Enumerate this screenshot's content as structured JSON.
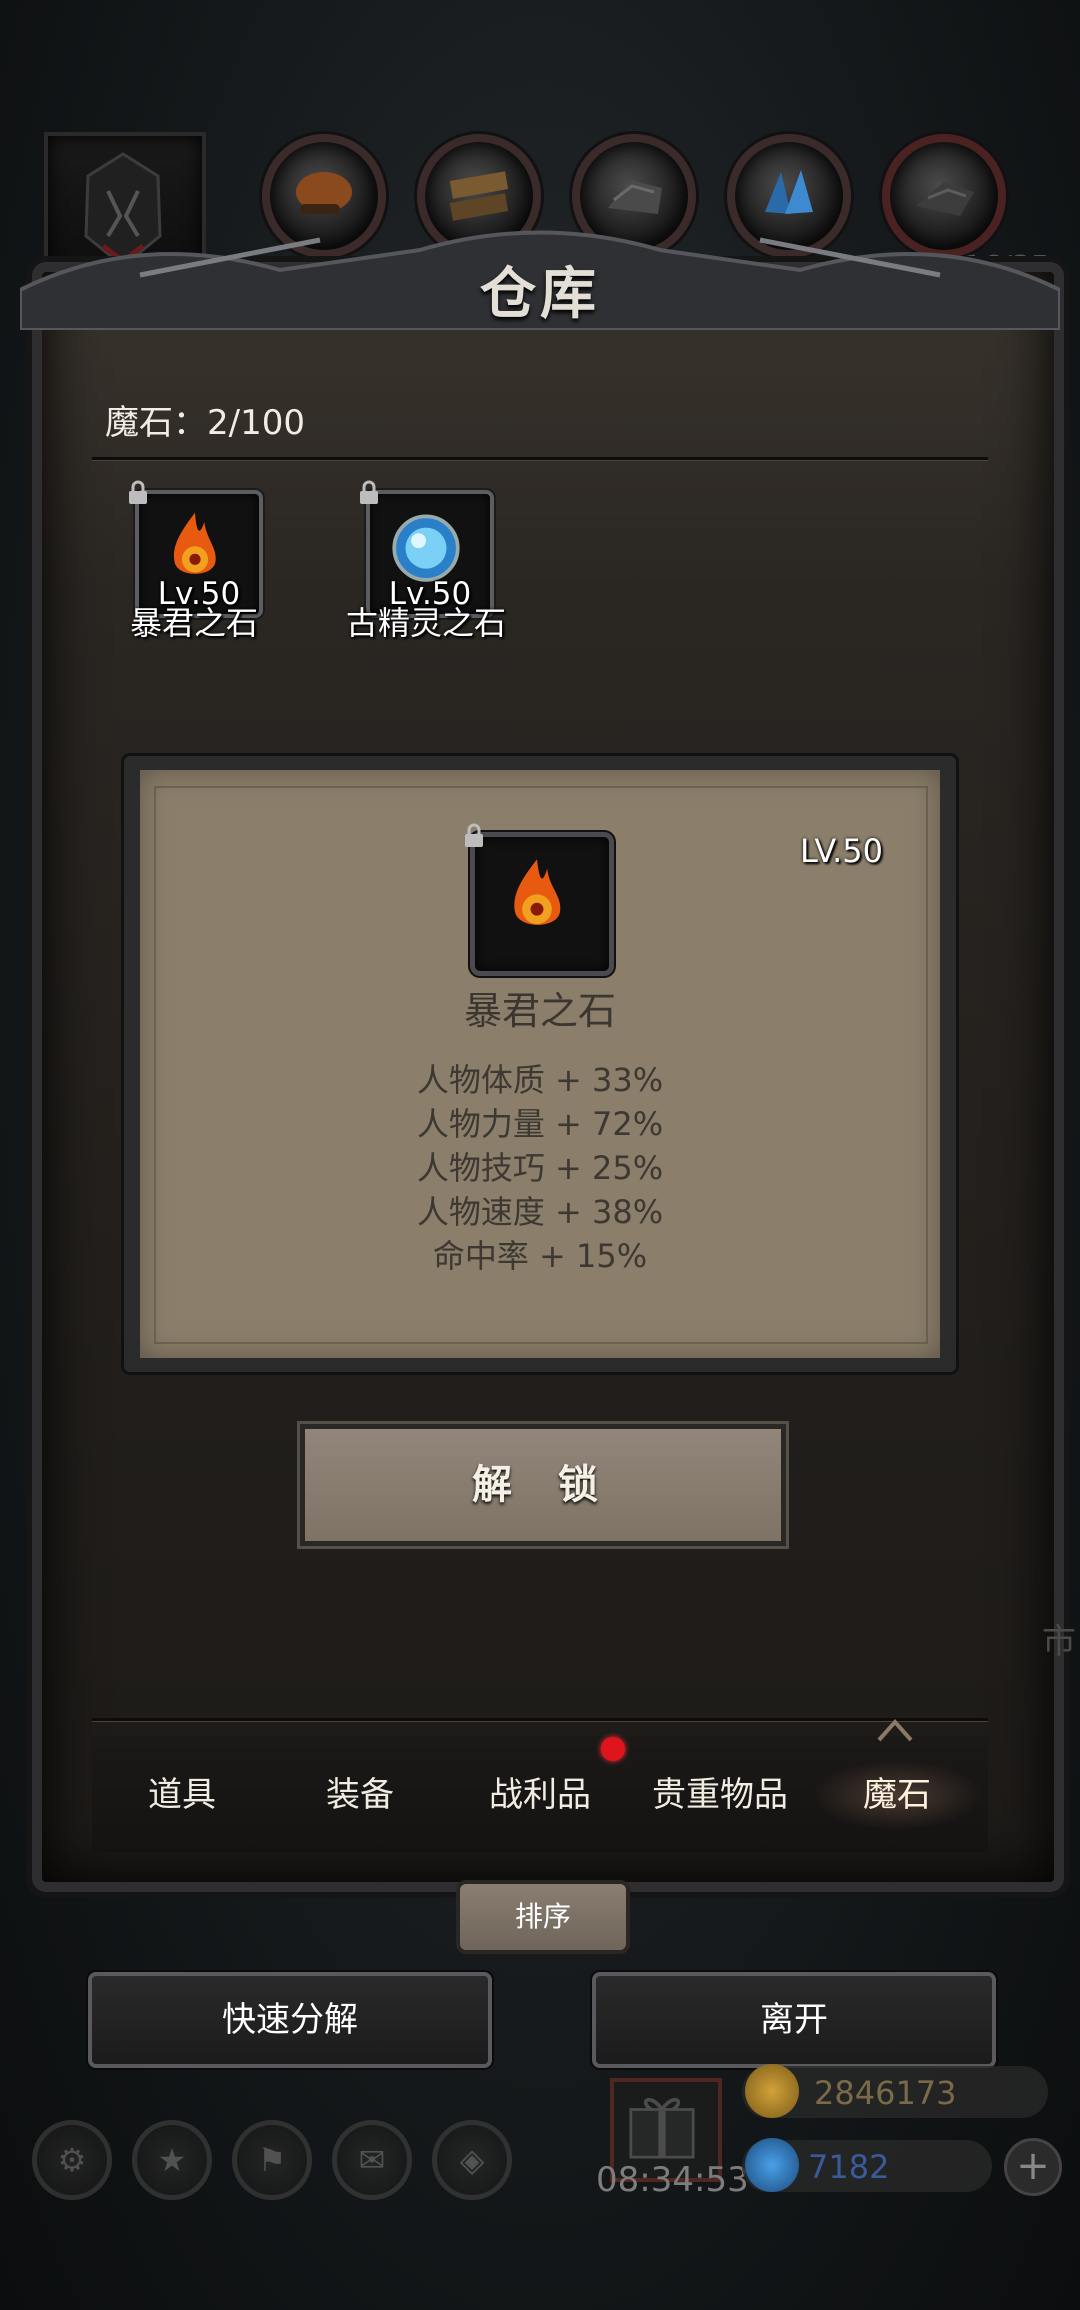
{
  "warehouse": {
    "title": "仓库",
    "capacity_label": "魔石：2/100",
    "items": [
      {
        "name": "暴君之石",
        "level": "Lv.50",
        "icon": "fire-stone-icon",
        "locked": true
      },
      {
        "name": "古精灵之石",
        "level": "Lv.50",
        "icon": "ice-stone-icon",
        "locked": true
      }
    ],
    "selected": {
      "name": "暴君之石",
      "level": "LV.50",
      "icon": "fire-stone-icon",
      "stats": [
        "人物体质 + 33%",
        "人物力量 + 72%",
        "人物技巧 + 25%",
        "人物速度 + 38%",
        "命中率 + 15%"
      ]
    },
    "unlock_label": "解 锁",
    "tabs": [
      {
        "label": "道具",
        "active": false
      },
      {
        "label": "装备",
        "active": false
      },
      {
        "label": "战利品",
        "active": false,
        "notification": true
      },
      {
        "label": "贵重物品",
        "active": false
      },
      {
        "label": "魔石",
        "active": true
      }
    ],
    "sort_label": "排序",
    "quick_decompose_label": "快速分解",
    "leave_label": "离开"
  },
  "top_bar": {
    "icons": [
      "helmet-portrait-icon",
      "food-icon",
      "wood-icon",
      "stone-icon",
      "crystal-icon",
      "iron-icon"
    ],
    "right_text": "16/35"
  },
  "hud": {
    "timer": "08:34:53",
    "gold": "2846173",
    "gems": "7182",
    "plus_label": "+",
    "faded_text": "市"
  },
  "colors": {
    "panel": "#2a2622",
    "card": "#8b7f6b",
    "button": "#8a7e71",
    "notification": "#e0141c"
  }
}
